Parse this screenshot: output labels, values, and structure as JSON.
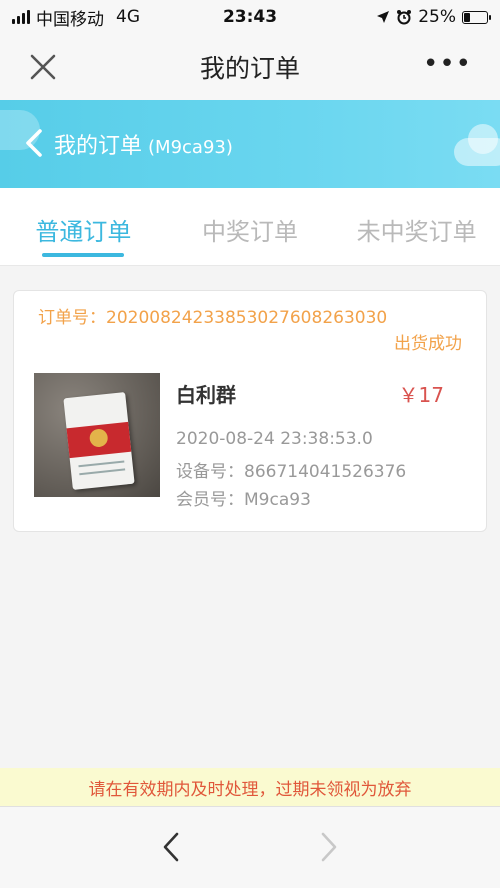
{
  "status_bar": {
    "carrier": "中国移动",
    "network": "4G",
    "time": "23:43",
    "battery": "25%",
    "battery_level": 0.25
  },
  "nav": {
    "title": "我的订单",
    "more": "•••"
  },
  "banner": {
    "title": "我的订单",
    "member_id": "(M9ca93)"
  },
  "tabs": [
    {
      "label": "普通订单",
      "active": true
    },
    {
      "label": "中奖订单",
      "active": false
    },
    {
      "label": "未中奖订单",
      "active": false
    }
  ],
  "order": {
    "order_no_label": "订单号：",
    "order_no": "20200824233853027608263030",
    "status": "出货成功",
    "product_name": "白利群",
    "price": "￥17",
    "time": "2020-08-24 23:38:53.0",
    "device_label": "设备号：",
    "device_no": "866714041526376",
    "member_label": "会员号：",
    "member_no": "M9ca93"
  },
  "notice": "请在有效期内及时处理，过期未领视为放弃",
  "colors": {
    "accent": "#3cb8df",
    "banner": "#5fd2ec",
    "order_orange": "#f2a24a",
    "price_red": "#d9534f",
    "notice_bg": "#fafad0",
    "notice_text": "#e0573a"
  }
}
